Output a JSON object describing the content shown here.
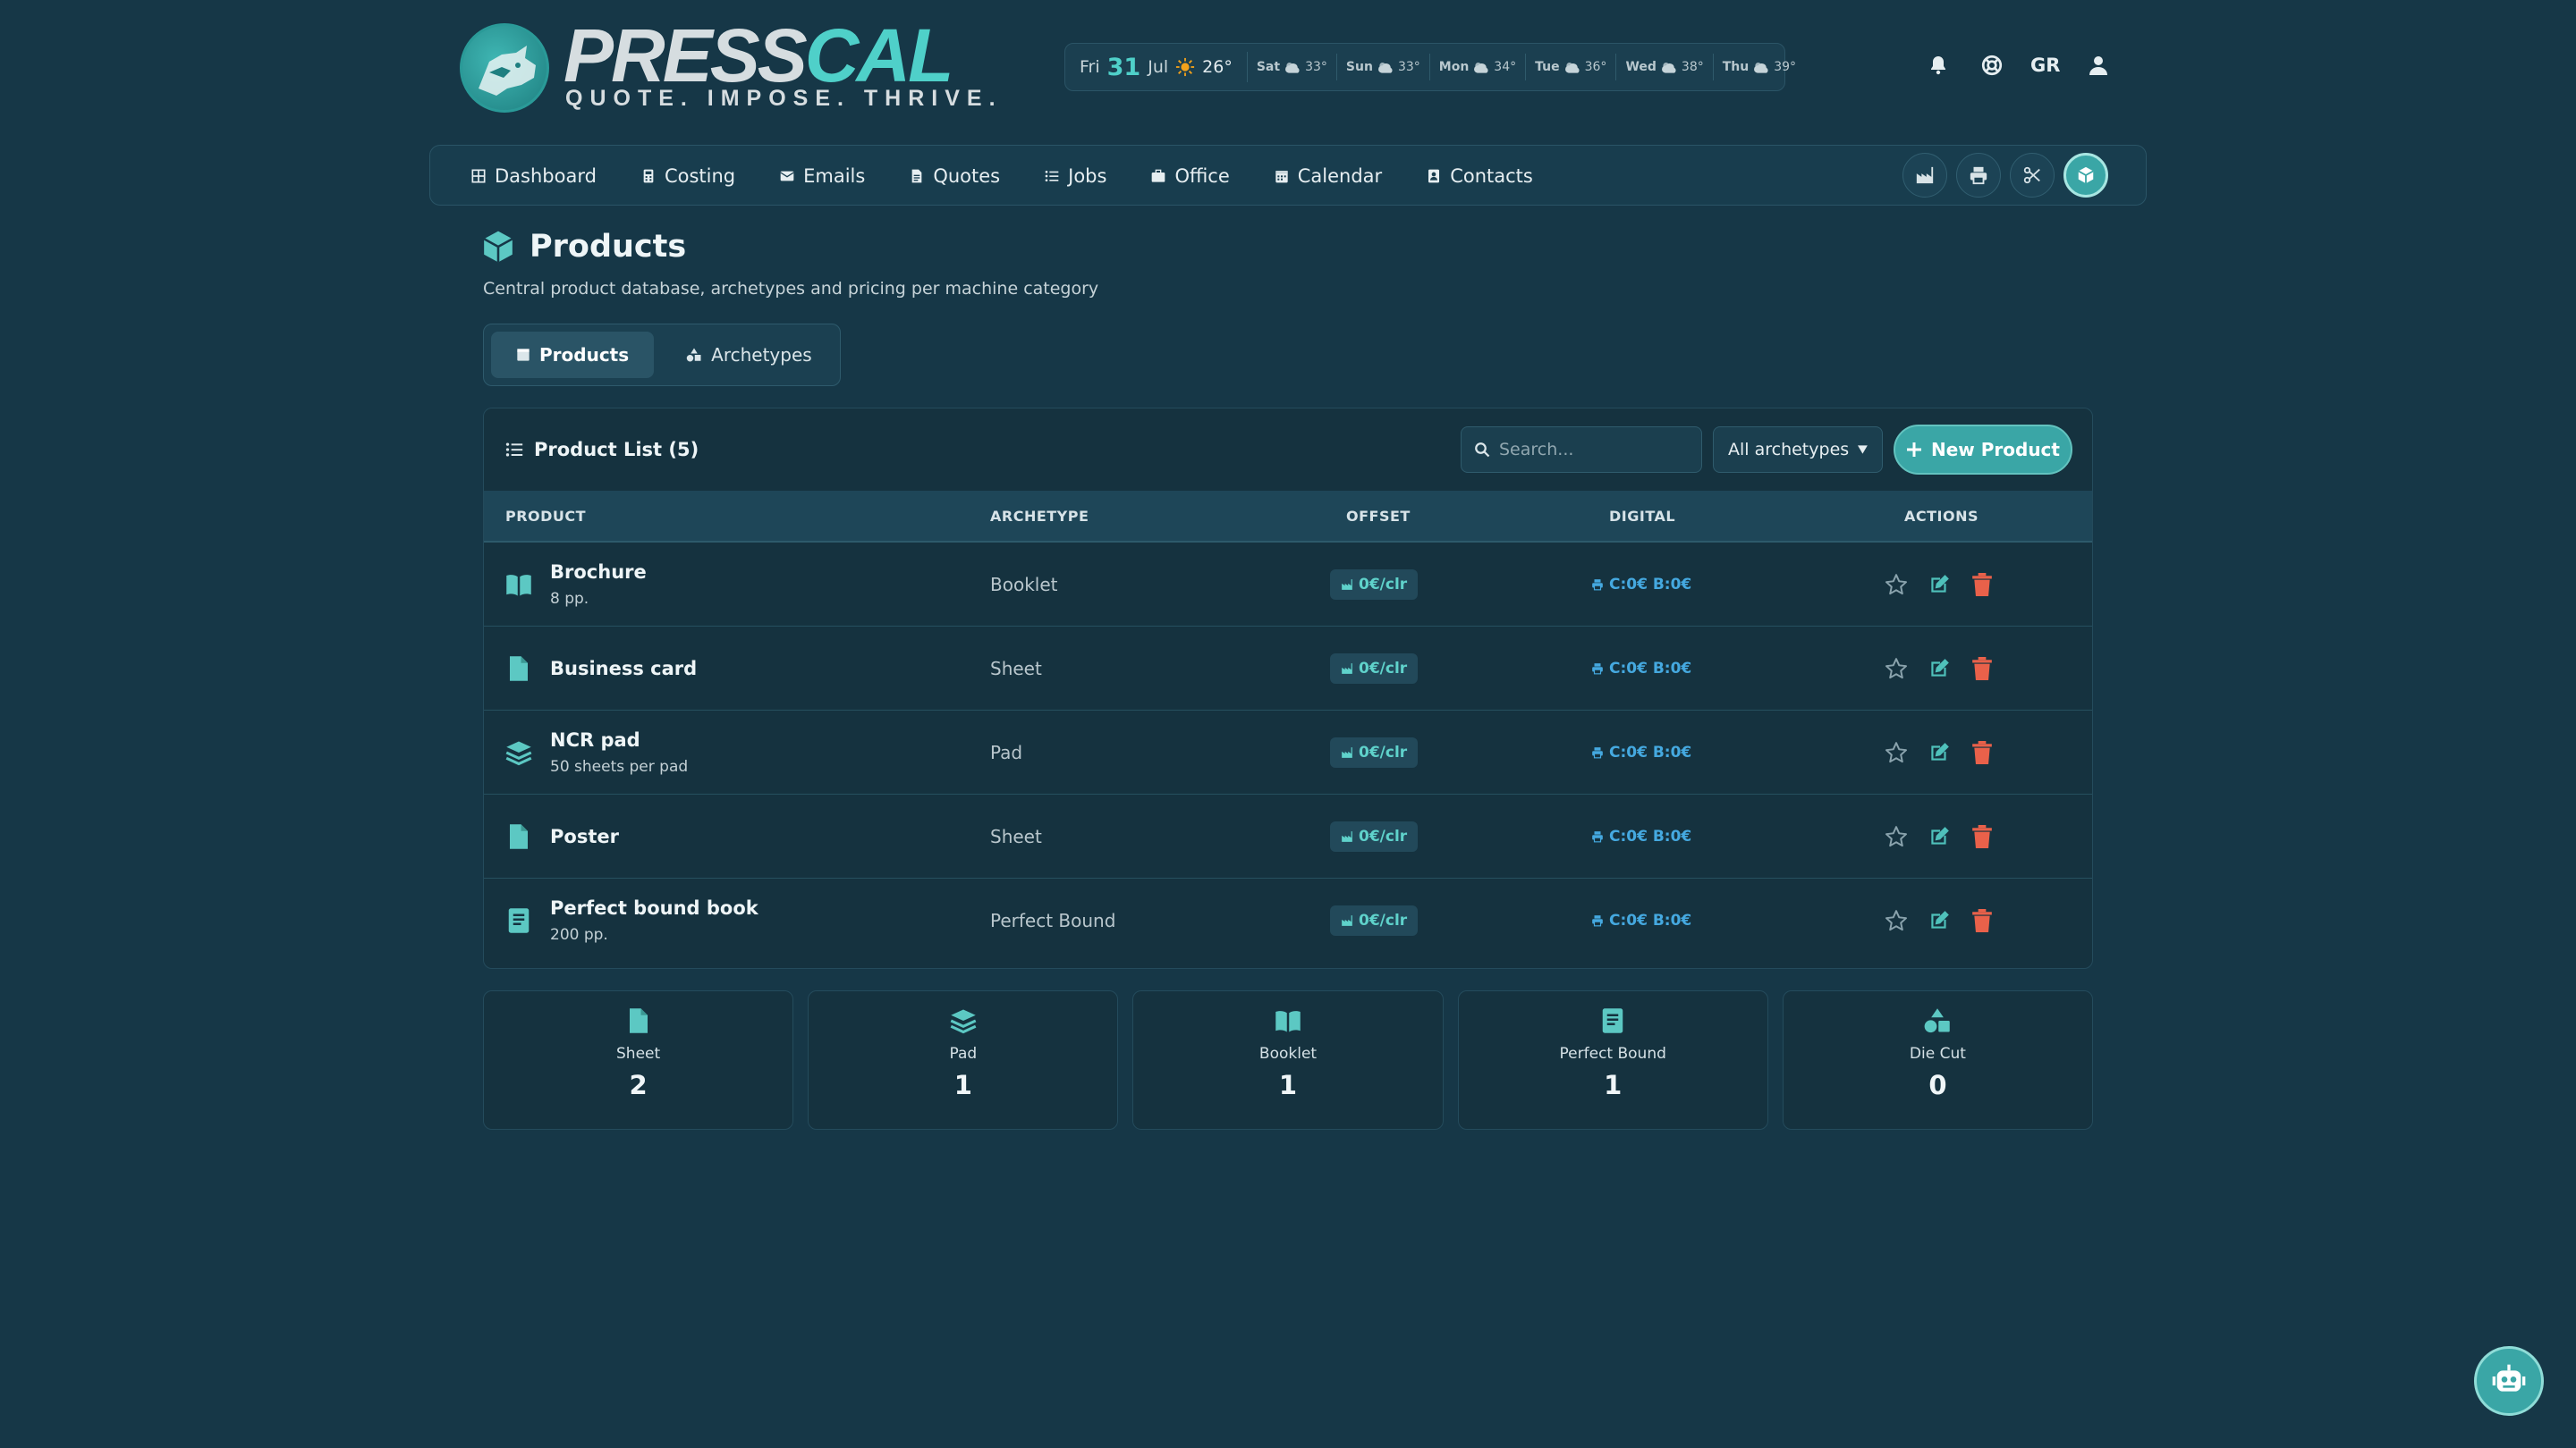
{
  "brand": {
    "name_pre": "PRESS",
    "name_post": "CAL",
    "tagline": "QUOTE. IMPOSE. THRIVE."
  },
  "weather": {
    "today": {
      "day": "Fri",
      "date": "31",
      "month": "Jul",
      "temp": "26°",
      "icon": "sun-icon"
    },
    "forecast": [
      {
        "day": "Sat",
        "temp": "33°"
      },
      {
        "day": "Sun",
        "temp": "33°"
      },
      {
        "day": "Mon",
        "temp": "34°"
      },
      {
        "day": "Tue",
        "temp": "36°"
      },
      {
        "day": "Wed",
        "temp": "38°"
      },
      {
        "day": "Thu",
        "temp": "39°"
      }
    ]
  },
  "header": {
    "language": "GR"
  },
  "nav": {
    "items": [
      {
        "label": "Dashboard",
        "icon": "dashboard-icon"
      },
      {
        "label": "Costing",
        "icon": "calculator-icon"
      },
      {
        "label": "Emails",
        "icon": "envelope-icon"
      },
      {
        "label": "Quotes",
        "icon": "document-icon"
      },
      {
        "label": "Jobs",
        "icon": "list-icon"
      },
      {
        "label": "Office",
        "icon": "briefcase-icon"
      },
      {
        "label": "Calendar",
        "icon": "calendar-icon"
      },
      {
        "label": "Contacts",
        "icon": "contacts-icon"
      }
    ],
    "tools": [
      "factory-icon",
      "printer-icon",
      "scissors-icon",
      "box-icon"
    ]
  },
  "page": {
    "title": "Products",
    "subtitle": "Central product database, archetypes and pricing per machine category",
    "tabs": [
      {
        "label": "Products",
        "active": true
      },
      {
        "label": "Archetypes",
        "active": false
      }
    ]
  },
  "product_list": {
    "title": "Product List (5)",
    "search_placeholder": "Search...",
    "filter_value": "All archetypes",
    "new_button": "New Product",
    "columns": [
      "PRODUCT",
      "ARCHETYPE",
      "OFFSET",
      "DIGITAL",
      "ACTIONS"
    ],
    "rows": [
      {
        "name": "Brochure",
        "sub": "8 pp.",
        "archetype": "Booklet",
        "offset": "0€/clr",
        "digital": "C:0€ B:0€",
        "icon": "book-open-icon"
      },
      {
        "name": "Business card",
        "sub": "",
        "archetype": "Sheet",
        "offset": "0€/clr",
        "digital": "C:0€ B:0€",
        "icon": "file-icon"
      },
      {
        "name": "NCR pad",
        "sub": "50 sheets per pad",
        "archetype": "Pad",
        "offset": "0€/clr",
        "digital": "C:0€ B:0€",
        "icon": "layers-icon"
      },
      {
        "name": "Poster",
        "sub": "",
        "archetype": "Sheet",
        "offset": "0€/clr",
        "digital": "C:0€ B:0€",
        "icon": "file-icon"
      },
      {
        "name": "Perfect bound book",
        "sub": "200 pp.",
        "archetype": "Perfect Bound",
        "offset": "0€/clr",
        "digital": "C:0€ B:0€",
        "icon": "book-icon"
      }
    ]
  },
  "stats": [
    {
      "label": "Sheet",
      "count": "2",
      "icon": "file-icon"
    },
    {
      "label": "Pad",
      "count": "1",
      "icon": "layers-icon"
    },
    {
      "label": "Booklet",
      "count": "1",
      "icon": "book-open-icon"
    },
    {
      "label": "Perfect Bound",
      "count": "1",
      "icon": "book-icon"
    },
    {
      "label": "Die Cut",
      "count": "0",
      "icon": "shapes-icon"
    }
  ],
  "colors": {
    "background": "#163747",
    "accent": "#3aa6a6",
    "teal": "#5cc8c3",
    "danger": "#e9614a",
    "digital": "#45a9e0"
  }
}
